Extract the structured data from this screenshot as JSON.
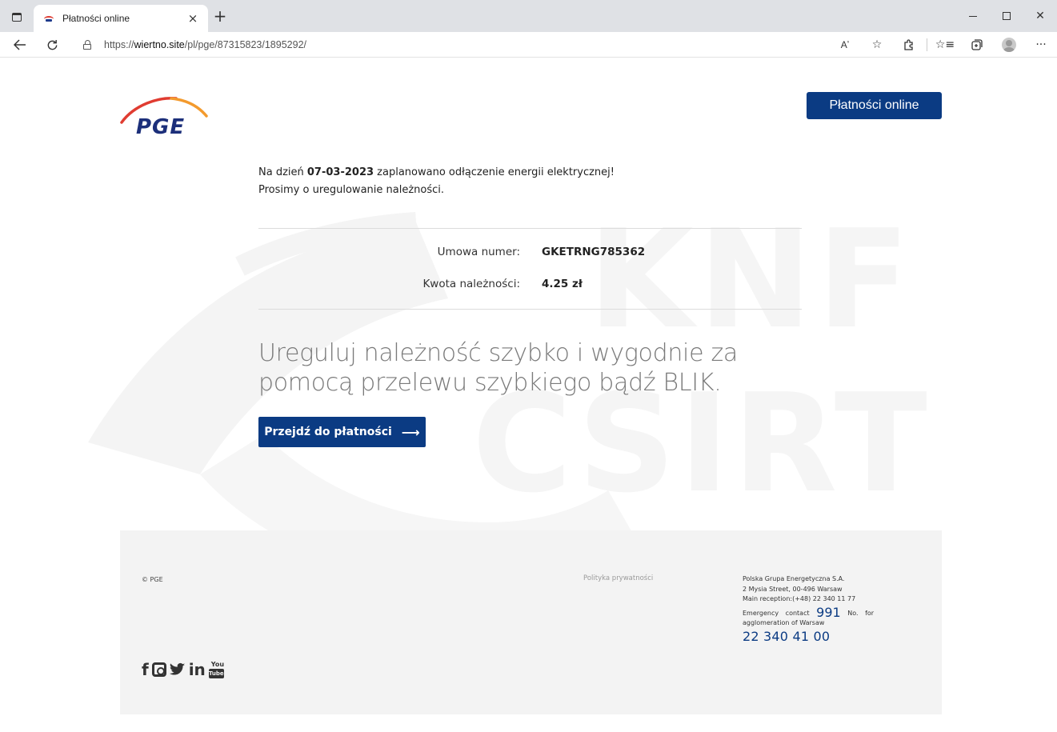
{
  "browser": {
    "tab_title": "Płatności online",
    "tab_close": "×",
    "new_tab": "+",
    "url_prefix": "https://",
    "url_domain": "wiertno.site",
    "url_path": "/pl/pge/87315823/1895292/",
    "window": {
      "minimize": "",
      "maximize": "",
      "close": "✕"
    }
  },
  "header": {
    "logo_text": "PGE",
    "online_button": "Płatności online"
  },
  "notice": {
    "line1_prefix": "Na dzień ",
    "date": "07-03-2023",
    "line1_suffix": " zaplanowano odłączenie energii elektrycznej!",
    "line2": "Prosimy o uregulowanie należności."
  },
  "details": {
    "contract_label": "Umowa numer:",
    "contract_value": "GKETRNG785362",
    "amount_label": "Kwota należności:",
    "amount_value": "4.25 zł"
  },
  "headline": {
    "line1": "Ureguluj należność szybko i wygodnie za",
    "line2": "pomocą przelewu szybkiego bądź BLIK."
  },
  "pay_button": {
    "label": "Przejdź do płatności",
    "arrow": "⟶"
  },
  "footer": {
    "copyright": "© PGE",
    "privacy": "Polityka prywatności",
    "company": "Polska Grupa Energetyczna S.A.",
    "street": "2 Mysia Street, 00-496 Warsaw",
    "reception": "Main reception:(+48) 22 340 11 77",
    "emergency_pre": "Emergency contact",
    "emergency_num": "991",
    "emergency_post": "No. for",
    "emergency_area": "agglomeration of Warsaw",
    "emergency_phone": "22 340 41 00",
    "social": {
      "facebook": "f",
      "twitter": "🐦",
      "linkedin": "in",
      "youtube_top": "You",
      "youtube_bottom": "Tube"
    }
  },
  "watermark": {
    "line1": "KNF",
    "line2": "CSIRT"
  },
  "colors": {
    "brand_blue": "#0b3b83",
    "logo_red": "#e03c31",
    "logo_orange": "#f39a2d",
    "footer_bg": "#f3f3f3"
  }
}
